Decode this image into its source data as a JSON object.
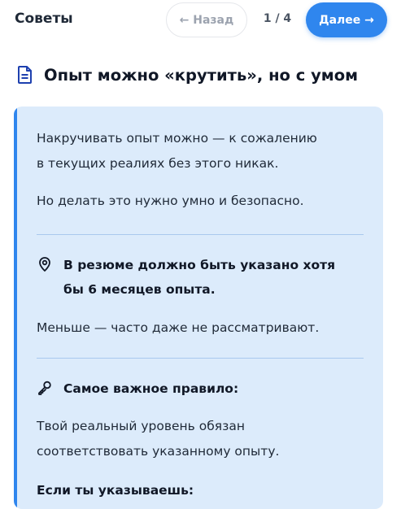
{
  "header": {
    "title": "Советы",
    "back_label": "← Назад",
    "page_counter": "1 / 4",
    "next_label": "Далее →",
    "accent_color": "#2f86ee"
  },
  "section": {
    "icon": "document-icon",
    "title": "Опыт можно «крутить», но с умом"
  },
  "card": {
    "intro_line1": "Накручивать опыт можно — к сожалению",
    "intro_line2": "в текущих реалиях без этого никак.",
    "intro_2": "Но делать это нужно умно и безопасно.",
    "pin_icon": "location-pin-icon",
    "rule1_line1": "В резюме должно быть указано хотя",
    "rule1_line2": "бы 6 месяцев опыта.",
    "rule1_note": "Меньше — часто даже не рассматривают.",
    "key_icon": "key-icon",
    "rule2_title": "Самое важное правило:",
    "rule2_line1": "Твой реальный уровень обязан",
    "rule2_line2": "соответствовать указанному опыту.",
    "rule2_followup": "Если ты указываешь:",
    "background_color": "#dcebfb"
  }
}
